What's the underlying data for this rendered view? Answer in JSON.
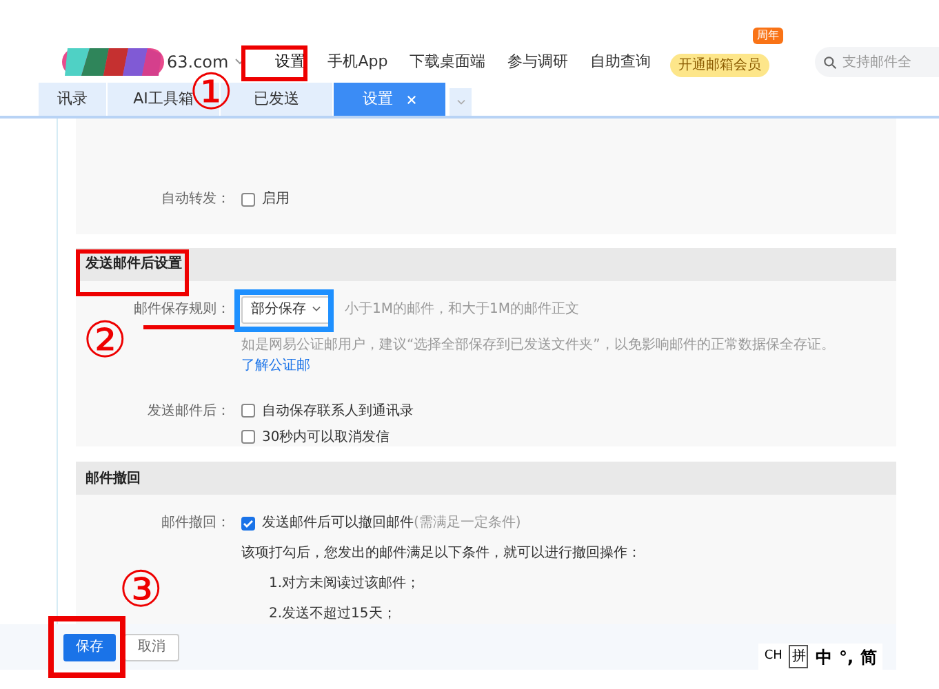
{
  "header": {
    "domain": "63.com",
    "nav": [
      {
        "label": "设置",
        "selected": true
      },
      {
        "label": "手机App",
        "selected": false
      },
      {
        "label": "下载桌面端",
        "selected": false
      },
      {
        "label": "参与调研",
        "selected": false
      },
      {
        "label": "自助查询",
        "selected": false
      }
    ],
    "vip": {
      "label": "开通邮箱会员",
      "tag": "周年"
    },
    "search": {
      "placeholder": "支持邮件全"
    }
  },
  "tabs": [
    {
      "label": "讯录",
      "selected": false,
      "closable": false
    },
    {
      "label": "AI工具箱",
      "selected": false,
      "closable": false
    },
    {
      "label": "已发送",
      "selected": false,
      "closable": false
    },
    {
      "label": "设置",
      "selected": true,
      "closable": true
    }
  ],
  "forward": {
    "label": "自动转发：",
    "option": {
      "label": "启用",
      "checked": false
    }
  },
  "after_send": {
    "title": "发送邮件后设置",
    "save_rule": {
      "label": "邮件保存规则：",
      "value": "部分保存",
      "description": "小于1M的邮件，和大于1M的邮件正文",
      "hint": "如是网易公证邮用户，建议“选择全部保存到已发送文件夹”，以免影响邮件的正常数据保全存证。",
      "link": "了解公证邮"
    },
    "after": {
      "label": "发送邮件后：",
      "options": [
        {
          "label": "自动保存联系人到通讯录",
          "checked": false
        },
        {
          "label": "30秒内可以取消发信",
          "checked": false
        }
      ]
    }
  },
  "recall": {
    "title": "邮件撤回",
    "label": "邮件撤回：",
    "option": {
      "label": "发送邮件后可以撤回邮件",
      "note": "(需满足一定条件)",
      "checked": true
    },
    "lines": [
      "该项打勾后，您发出的邮件满足以下条件，就可以进行撤回操作：",
      "1.对方未阅读过该邮件；",
      "2.发送不超过15天；"
    ]
  },
  "footer": {
    "buttons": [
      {
        "label": "保存",
        "kind": "primary"
      },
      {
        "label": "取消",
        "kind": "plain"
      }
    ]
  },
  "ime": [
    "CH",
    "拼",
    "中",
    "°,",
    "简"
  ],
  "annotations": [
    "①",
    "②",
    "③"
  ]
}
